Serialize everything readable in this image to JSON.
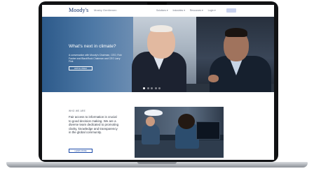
{
  "header": {
    "logo": "Moody's",
    "logo_sub": "Mosby Gentlemen",
    "nav": [
      "Solutions ▾",
      "Industries ▾",
      "Resources ▾",
      "Login ▾"
    ],
    "lang": "EN"
  },
  "hero": {
    "title": "What's next in climate?",
    "description": "A conversation with Moody's Chairman, CEO, Rob Fauber and BlackRock Chairman and CEO Larry Fink",
    "button": "WATCH VIDEO",
    "slides": 5,
    "active_slide": 1
  },
  "who_we_are": {
    "heading": "WHO WE ARE",
    "text": "Fair access to information is crucial to good decision making. We are a diverse team dedicated to promoting clarity, knowledge and transparency in the global community.",
    "button": "LEARN MORE"
  },
  "colors": {
    "brand": "#0a2a66",
    "accent": "#1b4aa8"
  }
}
